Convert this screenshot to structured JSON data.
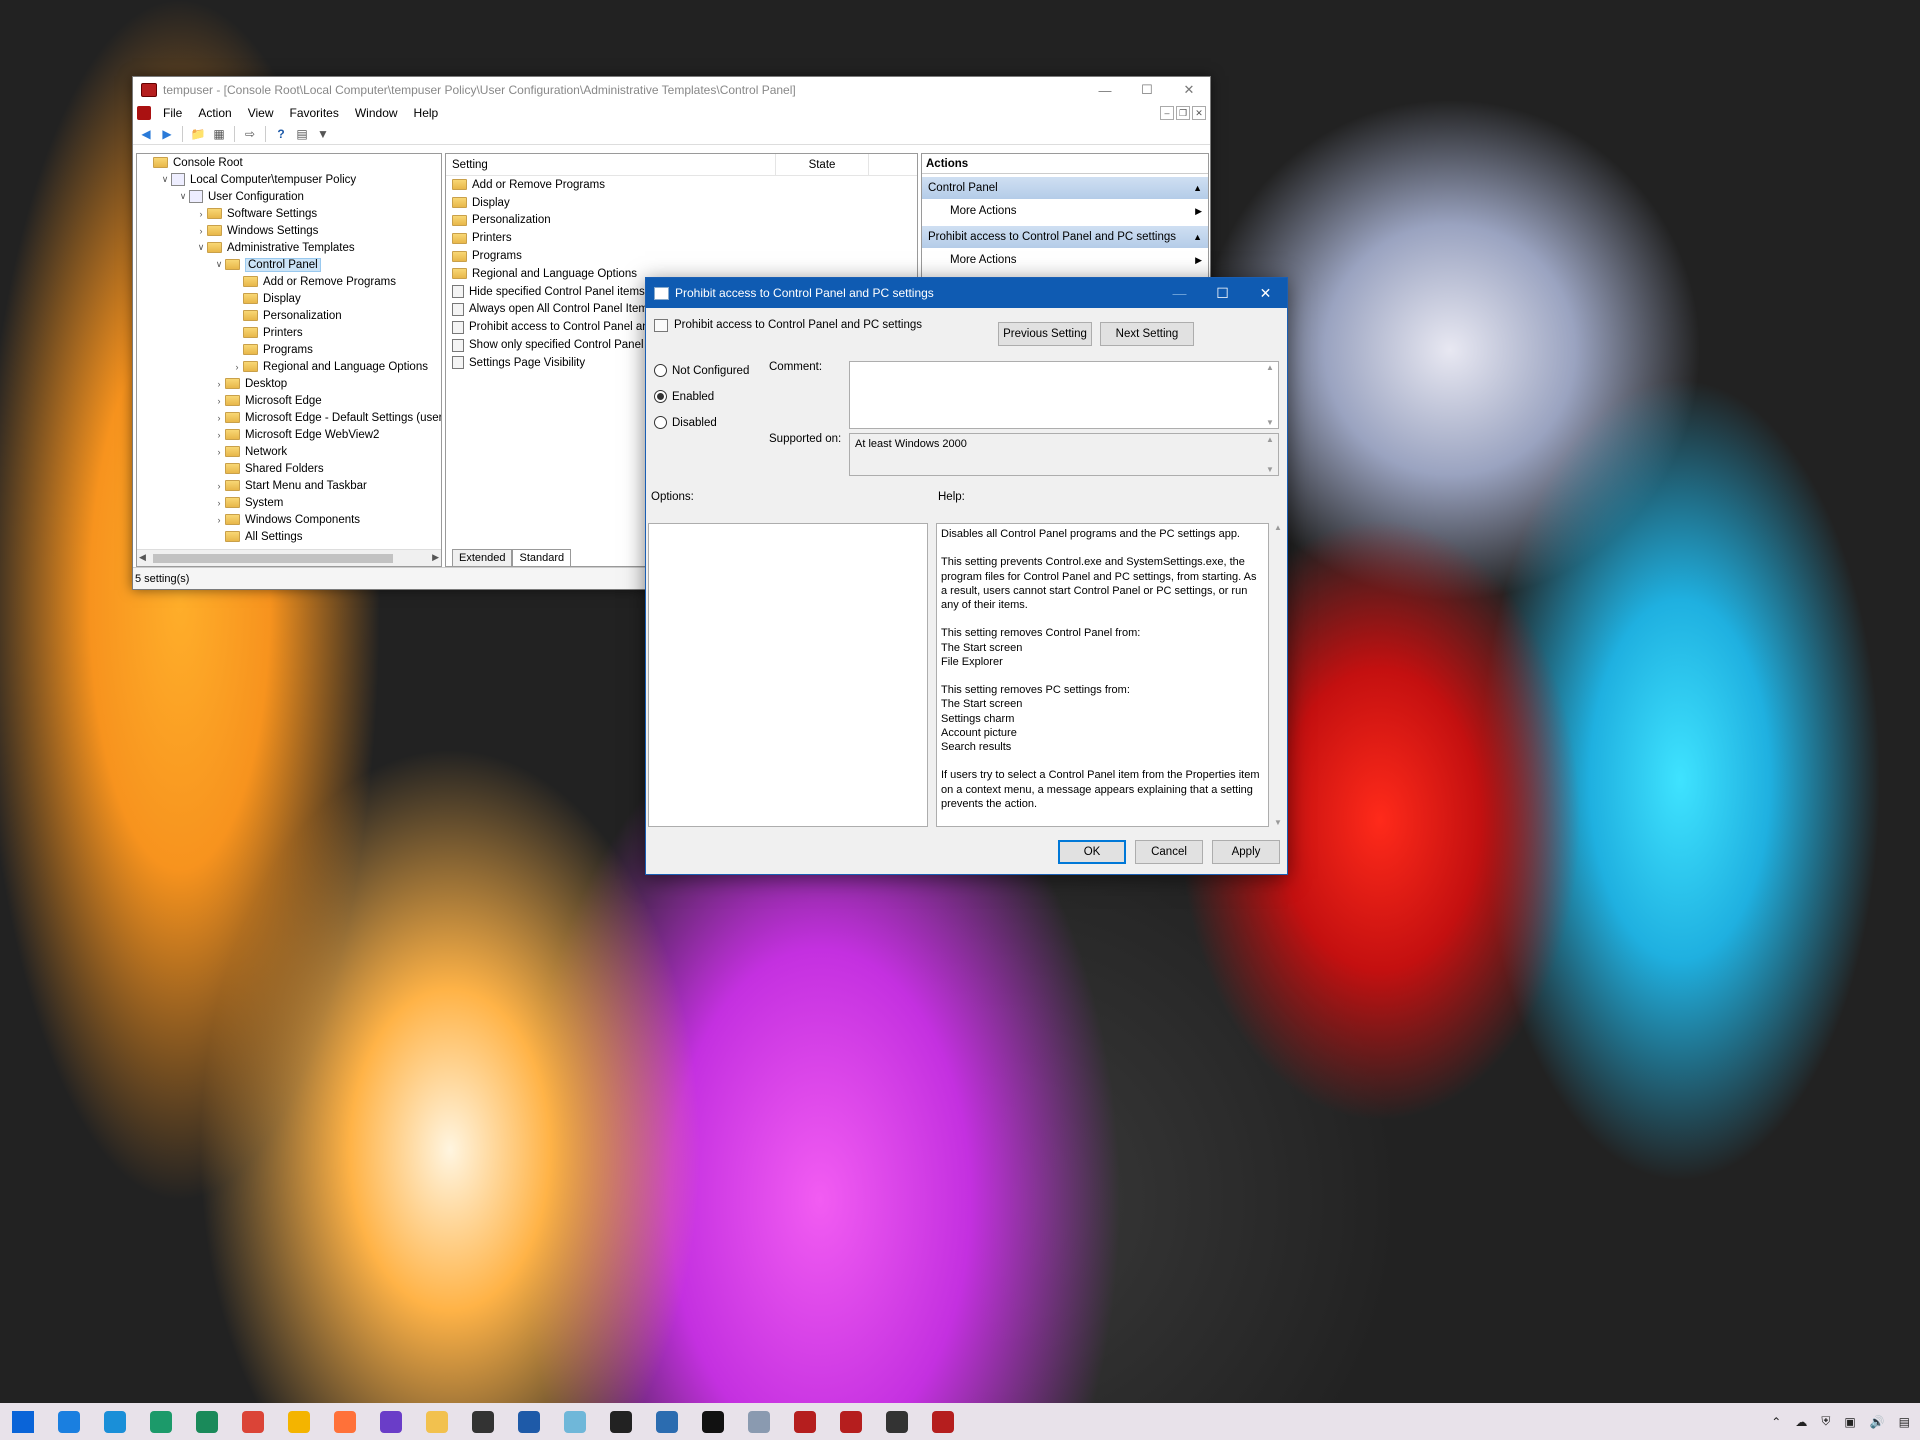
{
  "mmc": {
    "title": "tempuser - [Console Root\\Local Computer\\tempuser Policy\\User Configuration\\Administrative Templates\\Control Panel]",
    "menu": [
      "File",
      "Action",
      "View",
      "Favorites",
      "Window",
      "Help"
    ],
    "tree": [
      {
        "label": "Console Root",
        "indent": 0,
        "expander": "",
        "icon": "folder"
      },
      {
        "label": "Local Computer\\tempuser Policy",
        "indent": 1,
        "expander": "v",
        "icon": "policy"
      },
      {
        "label": "User Configuration",
        "indent": 2,
        "expander": "v",
        "icon": "policy"
      },
      {
        "label": "Software Settings",
        "indent": 3,
        "expander": ">",
        "icon": "folder"
      },
      {
        "label": "Windows Settings",
        "indent": 3,
        "expander": ">",
        "icon": "folder"
      },
      {
        "label": "Administrative Templates",
        "indent": 3,
        "expander": "v",
        "icon": "folder"
      },
      {
        "label": "Control Panel",
        "indent": 4,
        "expander": "v",
        "icon": "folder",
        "selected": true
      },
      {
        "label": "Add or Remove Programs",
        "indent": 5,
        "expander": "",
        "icon": "folder"
      },
      {
        "label": "Display",
        "indent": 5,
        "expander": "",
        "icon": "folder"
      },
      {
        "label": "Personalization",
        "indent": 5,
        "expander": "",
        "icon": "folder"
      },
      {
        "label": "Printers",
        "indent": 5,
        "expander": "",
        "icon": "folder"
      },
      {
        "label": "Programs",
        "indent": 5,
        "expander": "",
        "icon": "folder"
      },
      {
        "label": "Regional and Language Options",
        "indent": 5,
        "expander": ">",
        "icon": "folder"
      },
      {
        "label": "Desktop",
        "indent": 4,
        "expander": ">",
        "icon": "folder"
      },
      {
        "label": "Microsoft Edge",
        "indent": 4,
        "expander": ">",
        "icon": "folder"
      },
      {
        "label": "Microsoft Edge - Default Settings (users ca",
        "indent": 4,
        "expander": ">",
        "icon": "folder"
      },
      {
        "label": "Microsoft Edge WebView2",
        "indent": 4,
        "expander": ">",
        "icon": "folder"
      },
      {
        "label": "Network",
        "indent": 4,
        "expander": ">",
        "icon": "folder"
      },
      {
        "label": "Shared Folders",
        "indent": 4,
        "expander": "",
        "icon": "folder"
      },
      {
        "label": "Start Menu and Taskbar",
        "indent": 4,
        "expander": ">",
        "icon": "folder"
      },
      {
        "label": "System",
        "indent": 4,
        "expander": ">",
        "icon": "folder"
      },
      {
        "label": "Windows Components",
        "indent": 4,
        "expander": ">",
        "icon": "folder"
      },
      {
        "label": "All Settings",
        "indent": 4,
        "expander": "",
        "icon": "folder"
      }
    ],
    "columns": {
      "setting": "Setting",
      "state": "State"
    },
    "settings": [
      {
        "label": "Add or Remove Programs",
        "icon": "folder"
      },
      {
        "label": "Display",
        "icon": "folder"
      },
      {
        "label": "Personalization",
        "icon": "folder"
      },
      {
        "label": "Printers",
        "icon": "folder"
      },
      {
        "label": "Programs",
        "icon": "folder"
      },
      {
        "label": "Regional and Language Options",
        "icon": "folder"
      },
      {
        "label": "Hide specified Control Panel items",
        "icon": "setting"
      },
      {
        "label": "Always open All Control Panel Items",
        "icon": "setting"
      },
      {
        "label": "Prohibit access to Control Panel and",
        "icon": "setting"
      },
      {
        "label": "Show only specified Control Panel it",
        "icon": "setting"
      },
      {
        "label": "Settings Page Visibility",
        "icon": "setting"
      }
    ],
    "tabs": [
      "Extended",
      "Standard"
    ],
    "actions": {
      "header": "Actions",
      "sections": [
        {
          "title": "Control Panel",
          "item": "More Actions"
        },
        {
          "title": "Prohibit access to Control Panel and PC settings",
          "item": "More Actions"
        }
      ]
    },
    "status": "5 setting(s)"
  },
  "dialog": {
    "title": "Prohibit access to Control Panel and PC settings",
    "heading": "Prohibit access to Control Panel and PC settings",
    "prev": "Previous Setting",
    "next": "Next Setting",
    "radios": [
      {
        "label": "Not Configured",
        "checked": false
      },
      {
        "label": "Enabled",
        "checked": true
      },
      {
        "label": "Disabled",
        "checked": false
      }
    ],
    "comment_label": "Comment:",
    "supported_label": "Supported on:",
    "supported_value": "At least Windows 2000",
    "options_label": "Options:",
    "help_label": "Help:",
    "help_text": "Disables all Control Panel programs and the PC settings app.\n\nThis setting prevents Control.exe and SystemSettings.exe, the program files for Control Panel and PC settings, from starting. As a result, users cannot start Control Panel or PC settings, or run any of their items.\n\nThis setting removes Control Panel from:\nThe Start screen\nFile Explorer\n\nThis setting removes PC settings from:\nThe Start screen\nSettings charm\nAccount picture\nSearch results\n\nIf users try to select a Control Panel item from the Properties item on a context menu, a message appears explaining that a setting prevents the action.",
    "ok": "OK",
    "cancel": "Cancel",
    "apply": "Apply"
  },
  "taskbar": {
    "apps": [
      {
        "name": "windows-start-icon",
        "color": "#0a64d8"
      },
      {
        "name": "task-view-icon",
        "color": "#1a7fe0"
      },
      {
        "name": "edge-icon",
        "color": "#1a8fd8"
      },
      {
        "name": "edge-dev-icon",
        "color": "#1c9a6a"
      },
      {
        "name": "edge-canary-icon",
        "color": "#1a8a5a"
      },
      {
        "name": "chrome-icon",
        "color": "#db4437"
      },
      {
        "name": "chrome-canary-icon",
        "color": "#f4b400"
      },
      {
        "name": "firefox-icon",
        "color": "#ff7139"
      },
      {
        "name": "firefox-nightly-icon",
        "color": "#6a3dc8"
      },
      {
        "name": "file-explorer-icon",
        "color": "#f2c14e"
      },
      {
        "name": "store-icon",
        "color": "#333333"
      },
      {
        "name": "powershell-icon",
        "color": "#1e5aa8"
      },
      {
        "name": "notepad-icon",
        "color": "#6fb7d9"
      },
      {
        "name": "terminal-icon",
        "color": "#222222"
      },
      {
        "name": "photos-icon",
        "color": "#2b6cb0"
      },
      {
        "name": "console-icon",
        "color": "#111111"
      },
      {
        "name": "network-icon",
        "color": "#8a9ab0"
      },
      {
        "name": "gpedit-icon",
        "color": "#b51e1e"
      },
      {
        "name": "mmc-icon",
        "color": "#b51e1e"
      },
      {
        "name": "settings-gear-icon",
        "color": "#333333"
      },
      {
        "name": "toolbox-icon",
        "color": "#b51e1e"
      }
    ]
  }
}
